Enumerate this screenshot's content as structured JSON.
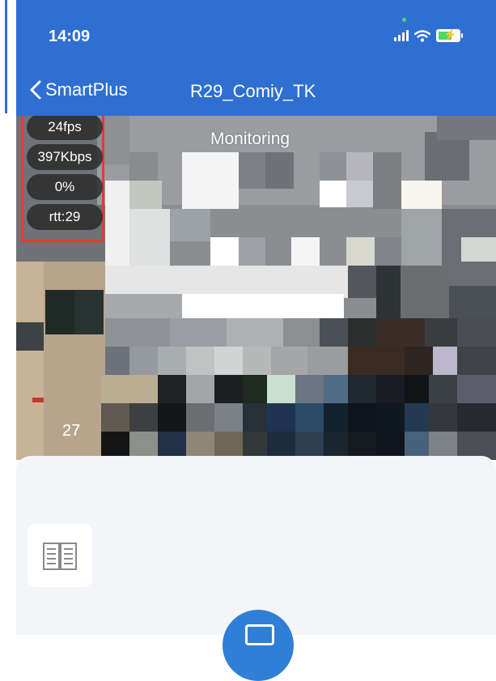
{
  "status_bar": {
    "time": "14:09"
  },
  "nav": {
    "back_label": "SmartPlus",
    "title": "R29_Comiy_TK"
  },
  "video": {
    "overlay_label": "Monitoring",
    "stats": [
      "24fps",
      "397Kbps",
      "0%",
      "rtt:29"
    ],
    "frame_count": "27"
  },
  "icons": {
    "back": "chevron-left-icon",
    "signal": "signal-icon",
    "wifi": "wifi-icon",
    "battery": "battery-charging-icon",
    "book": "open-book-icon",
    "fab": "monitor-icon"
  },
  "colors": {
    "header_blue": "#2f6fd1",
    "highlight_red": "#e53935",
    "fab_blue": "#2f7fd6"
  }
}
